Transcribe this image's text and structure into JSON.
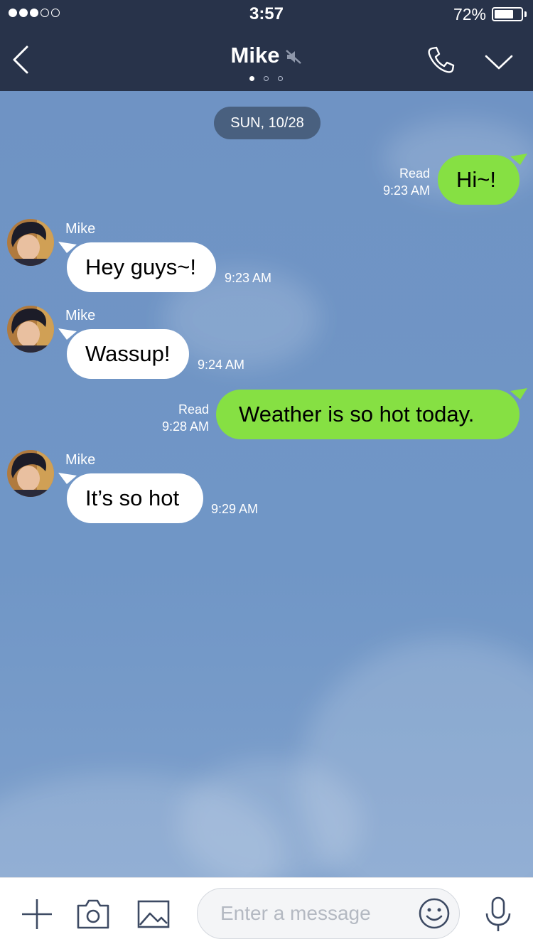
{
  "status_bar": {
    "time": "3:57",
    "battery": "72%",
    "battery_level": 0.72,
    "signal_bars": 3,
    "signal_total": 5
  },
  "header": {
    "title": "Mike",
    "pages": 3,
    "active_page": 1
  },
  "chat": {
    "date": "SUN, 10/28",
    "sender_name": "Mike"
  },
  "messages": [
    {
      "from": "me",
      "text": "Hi~!",
      "read": "Read",
      "time": "9:23 AM"
    },
    {
      "from": "Mike",
      "text": "Hey guys~!",
      "time": "9:23 AM"
    },
    {
      "from": "Mike",
      "text": "Wassup!",
      "time": "9:24 AM"
    },
    {
      "from": "me",
      "text": "Weather is so hot today.",
      "read": "Read",
      "time": "9:28 AM"
    },
    {
      "from": "Mike",
      "text": "It’s so hot",
      "time": "9:29 AM"
    }
  ],
  "input": {
    "placeholder": "Enter a message"
  },
  "icons": {
    "back": "chevron-left-icon",
    "mute": "mute-icon",
    "call": "phone-icon",
    "menu": "chevron-down-icon",
    "add": "plus-icon",
    "camera": "camera-icon",
    "gallery": "image-icon",
    "emoji": "smiley-icon",
    "voice": "microphone-icon"
  },
  "colors": {
    "header": "#28334a",
    "chat_background": "#6f93c4",
    "my_bubble": "#86e043",
    "their_bubble": "#ffffff",
    "date_chip": "#49607f",
    "icon_stroke": "#3d4a63"
  }
}
